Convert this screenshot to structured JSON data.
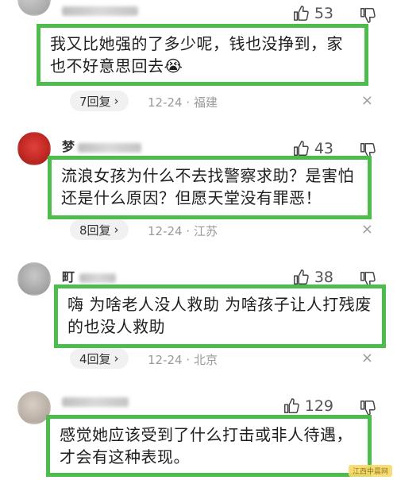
{
  "comments": [
    {
      "username": "",
      "likes": "53",
      "text": "我又比她强的了多少呢，钱也没挣到，家也不好意思回去😭",
      "replies": "7回复",
      "date": "12-24",
      "location": "福建"
    },
    {
      "username": "梦",
      "likes": "43",
      "text": "流浪女孩为什么不去找警察求助？是害怕还是什么原因？但愿天堂没有罪恶！",
      "replies": "8回复",
      "date": "12-24",
      "location": "江苏"
    },
    {
      "username": "町",
      "likes": "38",
      "text": "嗨 为啥老人没人救助 为啥孩子让人打残废的也没人救助",
      "replies": "4回复",
      "date": "12-24",
      "location": "北京"
    },
    {
      "username": "",
      "likes": "129",
      "text": "感觉她应该受到了什么打击或非人待遇，才会有这种表现。"
    }
  ],
  "meta_separator": "·",
  "close_glyph": "×",
  "reply_arrow": "›",
  "watermark": "江西中晨网",
  "colors": {
    "highlight_border": "#4cbd4c",
    "meta_gray": "#9a9a9a"
  },
  "icons": {
    "like": "thumbs-up-icon",
    "dislike": "thumbs-down-icon",
    "avatar": "avatar",
    "close": "close-icon"
  }
}
